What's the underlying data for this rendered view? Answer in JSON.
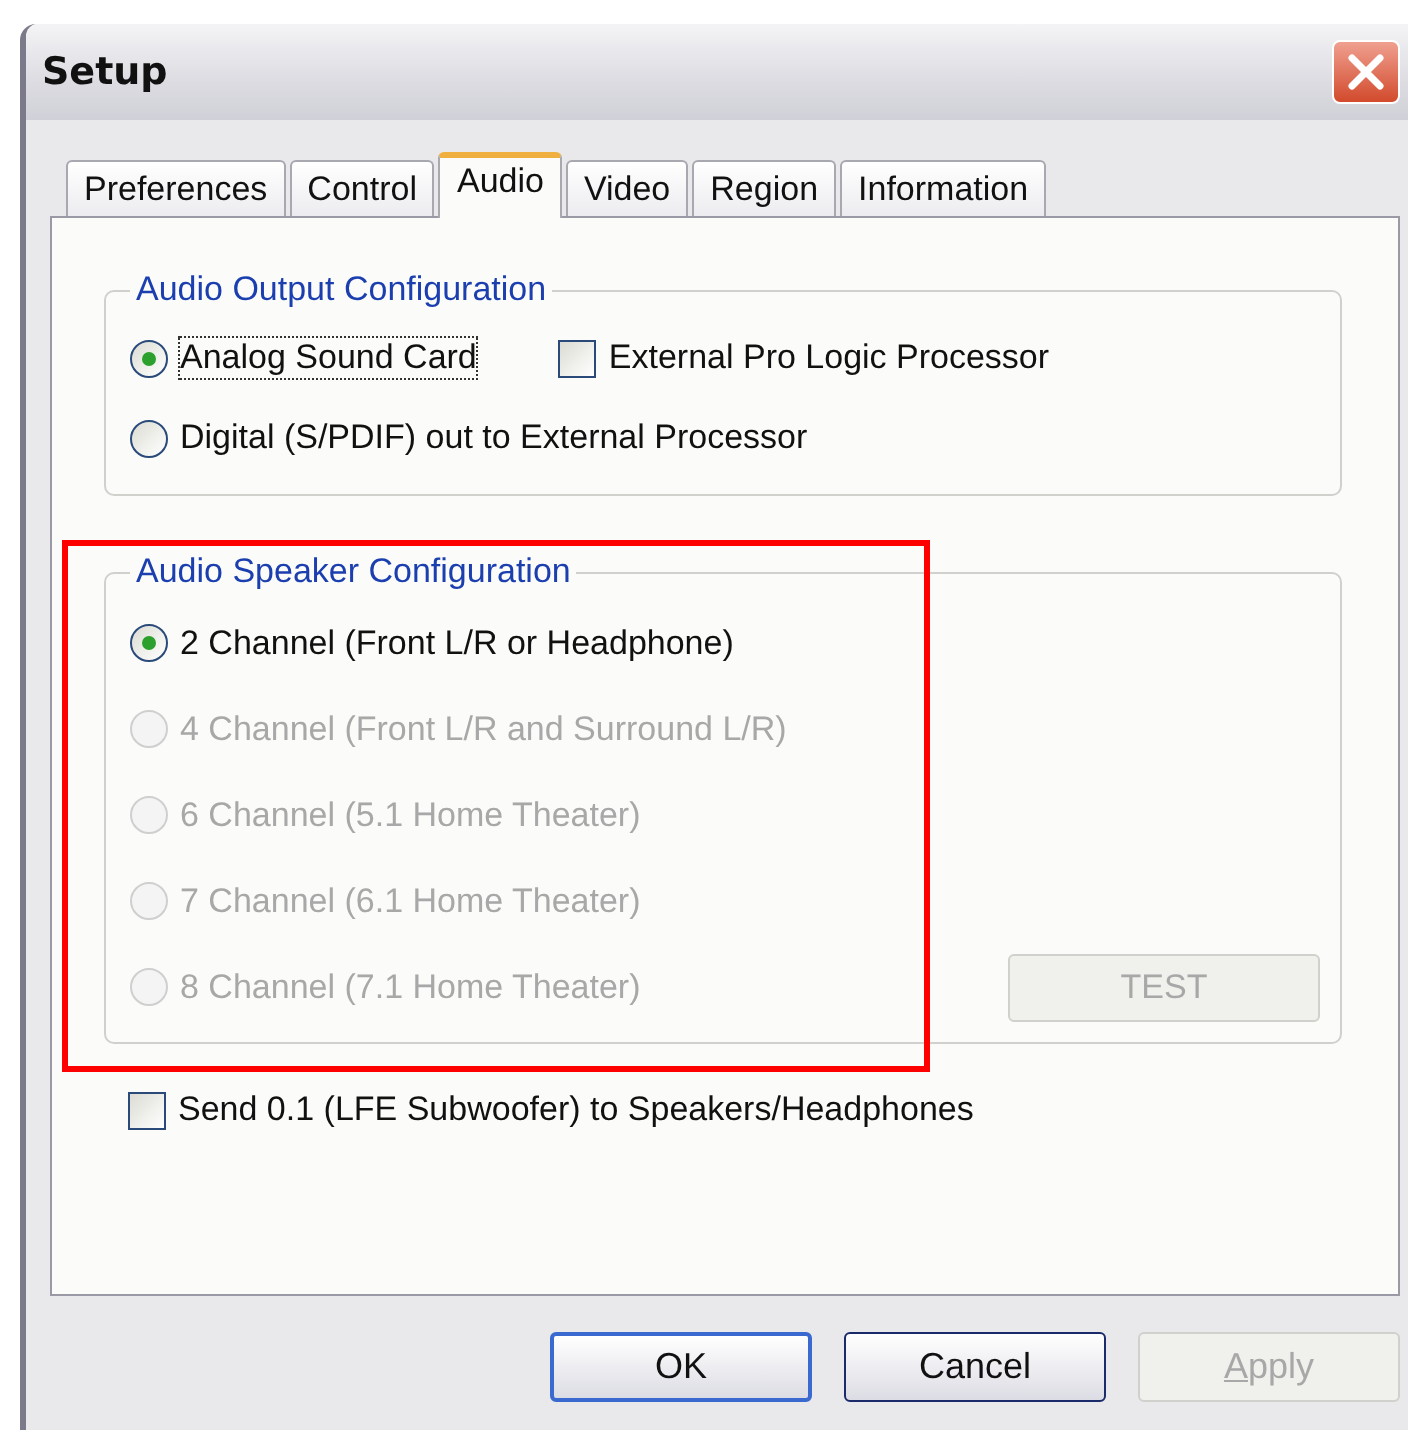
{
  "window": {
    "title": "Setup"
  },
  "tabs": [
    {
      "label": "Preferences",
      "selected": false
    },
    {
      "label": "Control",
      "selected": false
    },
    {
      "label": "Audio",
      "selected": true
    },
    {
      "label": "Video",
      "selected": false
    },
    {
      "label": "Region",
      "selected": false
    },
    {
      "label": "Information",
      "selected": false
    }
  ],
  "output_group": {
    "title": "Audio Output Configuration",
    "rows": [
      [
        {
          "kind": "radio",
          "label": "Analog Sound Card",
          "selected": true,
          "focused": true
        },
        {
          "kind": "checkbox",
          "label": "External Pro Logic Processor",
          "checked": false,
          "focused": false
        }
      ],
      [
        {
          "kind": "radio",
          "label": "Digital (S/PDIF) out to External Processor",
          "selected": false,
          "focused": false
        }
      ]
    ]
  },
  "speaker_group": {
    "title": "Audio Speaker Configuration",
    "highlighted": true,
    "options": [
      {
        "label": "2 Channel (Front L/R or Headphone)",
        "selected": true,
        "disabled": false
      },
      {
        "label": "4 Channel (Front L/R and Surround L/R)",
        "selected": false,
        "disabled": true
      },
      {
        "label": "6 Channel (5.1 Home Theater)",
        "selected": false,
        "disabled": true
      },
      {
        "label": "7 Channel (6.1 Home Theater)",
        "selected": false,
        "disabled": true
      },
      {
        "label": "8 Channel (7.1 Home Theater)",
        "selected": false,
        "disabled": true
      }
    ],
    "test_button": {
      "label": "TEST",
      "disabled": true
    }
  },
  "lfe_checkbox": {
    "label": "Send 0.1 (LFE Subwoofer) to Speakers/Headphones",
    "checked": false
  },
  "buttons": [
    {
      "label": "OK",
      "default": true,
      "disabled": false,
      "mnemonic": false
    },
    {
      "label": "Cancel",
      "default": false,
      "disabled": false,
      "mnemonic": false
    },
    {
      "label": "Apply",
      "default": false,
      "disabled": true,
      "mnemonic": true
    }
  ]
}
